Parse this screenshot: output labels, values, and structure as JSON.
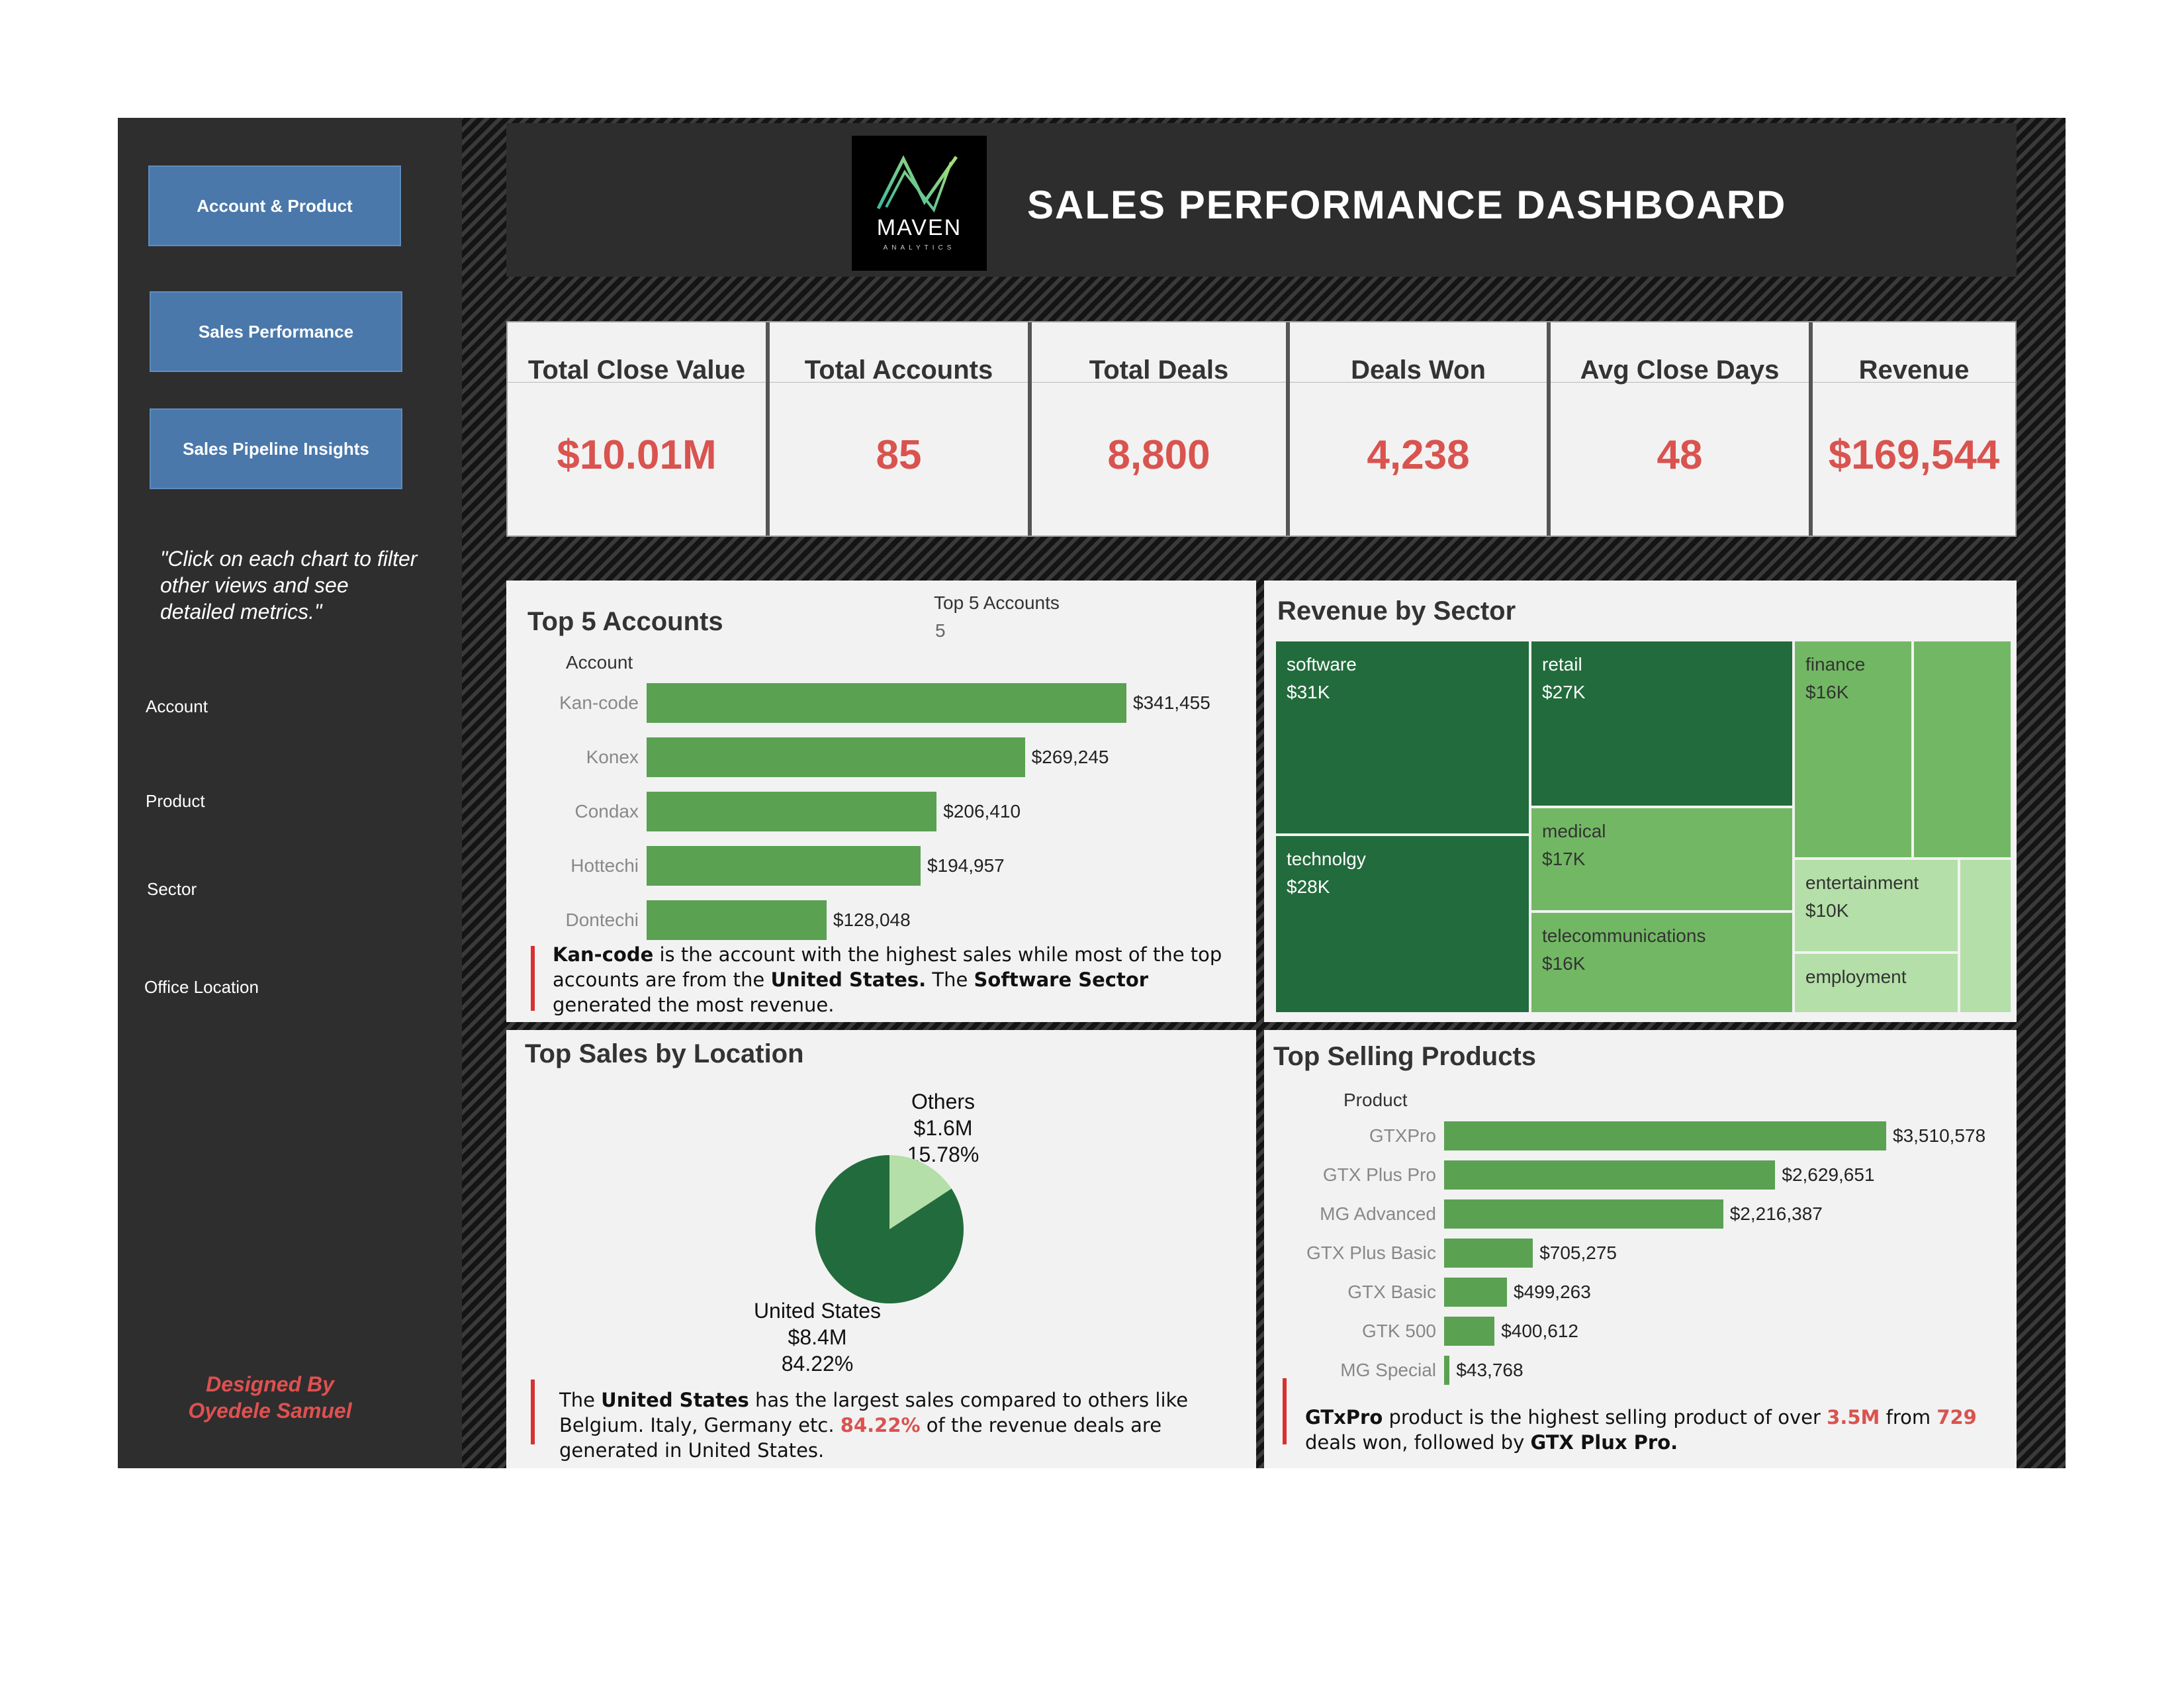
{
  "nav": {
    "buttons": [
      "Account & Product",
      "Sales Performance",
      "Sales Pipeline Insights"
    ],
    "hint": "\"Click on each chart to filter other views and see detailed metrics.\"",
    "filters": [
      "Account",
      "Product",
      "Sector",
      "Office Location"
    ],
    "designer_line1": "Designed By",
    "designer_line2": "Oyedele Samuel"
  },
  "header": {
    "logo_text": "MAVEN",
    "logo_sub": "ANALYTICS",
    "title": "SALES PERFORMANCE DASHBOARD"
  },
  "kpis": [
    {
      "label": "Total Close Value",
      "value": "$10.01M"
    },
    {
      "label": "Total Accounts",
      "value": "85"
    },
    {
      "label": "Total Deals",
      "value": "8,800"
    },
    {
      "label": "Deals Won",
      "value": "4,238"
    },
    {
      "label": "Avg Close Days",
      "value": "48"
    },
    {
      "label": "Revenue",
      "value": "$169,544"
    }
  ],
  "top_accounts": {
    "title": "Top 5 Accounts",
    "filter_label": "Top 5 Accounts",
    "filter_value": "5",
    "axis_label": "Account",
    "insight": {
      "p1": "Kan-code",
      "p2": " is the account with the highest sales while most of the top accounts are from the ",
      "p3": "United States.",
      "p4": " The ",
      "p5": "Software Sector",
      "p6": " generated the most revenue."
    }
  },
  "revenue_by_sector": {
    "title": "Revenue by Sector",
    "cells": [
      {
        "name": "software",
        "value": "$31K"
      },
      {
        "name": "retail",
        "value": "$27K"
      },
      {
        "name": "finance",
        "value": "$16K"
      },
      {
        "name": "technolgy",
        "value": "$28K"
      },
      {
        "name": "medical",
        "value": "$17K"
      },
      {
        "name": "entertainment",
        "value": "$10K"
      },
      {
        "name": "telecommunications",
        "value": "$16K"
      },
      {
        "name": "employment",
        "value": ""
      }
    ]
  },
  "top_location": {
    "title": "Top Sales by Location",
    "others_name": "Others",
    "others_value": "$1.6M",
    "others_pct": "15.78%",
    "us_name": "United States",
    "us_value": "$8.4M",
    "us_pct": "84.22%",
    "insight": {
      "p1": "The ",
      "p2": "United States",
      "p3": " has the largest sales compared to others like Belgium. Italy, Germany etc. ",
      "p4": "84.22%",
      "p5": " of the revenue deals are generated in United States."
    }
  },
  "top_products": {
    "title": "Top Selling Products",
    "axis_label": "Product",
    "insight": {
      "p1": "GTxPro",
      "p2": " product is the highest selling product of over ",
      "p3": "3.5M",
      "p4": " from ",
      "p5": "729",
      "p6": " deals won, followed by ",
      "p7": "GTX Plux Pro."
    }
  },
  "chart_data": [
    {
      "type": "bar",
      "title": "Top 5 Accounts",
      "ylabel": "Account",
      "categories": [
        "Kan-code",
        "Konex",
        "Condax",
        "Hottechi",
        "Dontechi"
      ],
      "values": [
        341455,
        269245,
        206410,
        194957,
        128048
      ],
      "labels": [
        "$341,455",
        "$269,245",
        "$206,410",
        "$194,957",
        "$128,048"
      ],
      "color": "#5aa152"
    },
    {
      "type": "pie",
      "title": "Top Sales by Location",
      "categories": [
        "United States",
        "Others"
      ],
      "values": [
        84.22,
        15.78
      ],
      "colors": [
        "#226b3c",
        "#b4dfa8"
      ]
    },
    {
      "type": "bar",
      "title": "Top Selling Products",
      "ylabel": "Product",
      "categories": [
        "GTXPro",
        "GTX Plus Pro",
        "MG Advanced",
        "GTX Plus Basic",
        "GTX Basic",
        "GTK 500",
        "MG Special"
      ],
      "values": [
        3510578,
        2629651,
        2216387,
        705275,
        499263,
        400612,
        43768
      ],
      "labels": [
        "$3,510,578",
        "$2,629,651",
        "$2,216,387",
        "$705,275",
        "$499,263",
        "$400,612",
        "$43,768"
      ],
      "color": "#5aa152"
    }
  ],
  "colors": {
    "accent_red": "#d9534f",
    "nav_blue": "#4a78aa",
    "dark_green": "#226b3c",
    "mid_green": "#72b864",
    "light_green": "#b4dfa8"
  }
}
